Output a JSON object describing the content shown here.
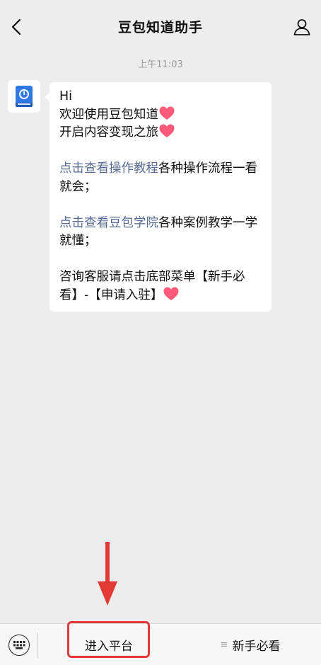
{
  "header": {
    "title": "豆包知道助手",
    "back_icon": "chevron-left-icon",
    "profile_icon": "person-icon"
  },
  "chat": {
    "timestamp": "上午11:03",
    "message": {
      "greeting": "Hi",
      "welcome": "欢迎使用豆包知道",
      "journey": "开启内容变现之旅",
      "link1": "点击查看操作教程",
      "link1_desc": "各种操作流程一看就会；",
      "link2": "点击查看豆包学院",
      "link2_desc": "各种案例教学一学就懂；",
      "service": "咨询客服请点击底部菜单【新手必看】-【申请入驻】"
    }
  },
  "footer": {
    "keyboard_icon": "keyboard-icon",
    "menu": [
      {
        "label": "进入平台"
      },
      {
        "label": "新手必看",
        "icon": "≡"
      }
    ]
  },
  "colors": {
    "link": "#576b95",
    "heart": "#ff5a7a",
    "annotation": "#e53935",
    "background": "#ededed"
  }
}
